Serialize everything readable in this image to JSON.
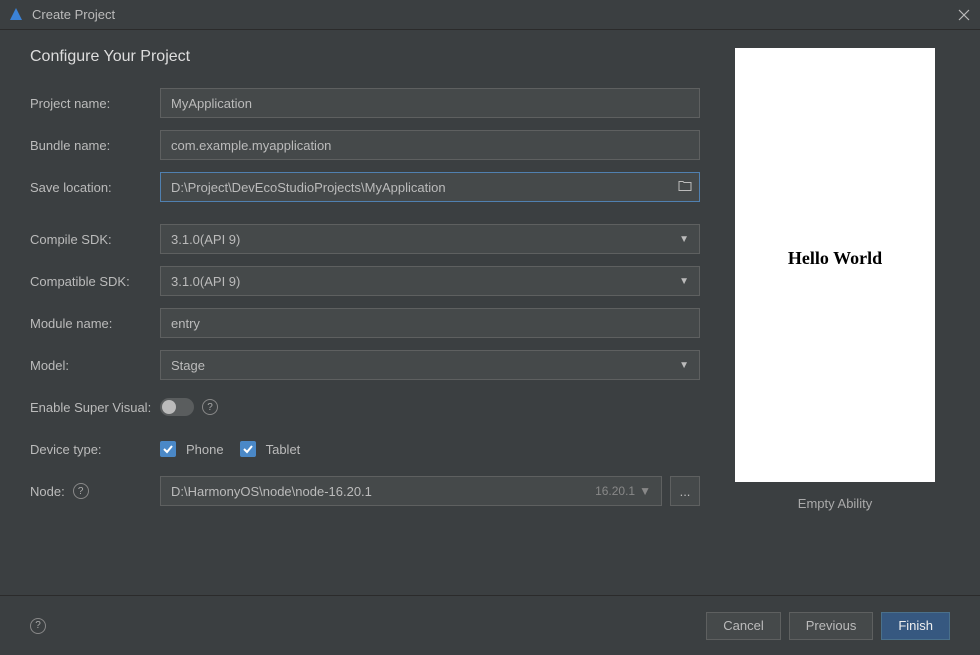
{
  "window": {
    "title": "Create Project"
  },
  "page_title": "Configure Your Project",
  "form": {
    "project_name": {
      "label": "Project name:",
      "value": "MyApplication"
    },
    "bundle_name": {
      "label": "Bundle name:",
      "value": "com.example.myapplication"
    },
    "save_location": {
      "label": "Save location:",
      "value": "D:\\Project\\DevEcoStudioProjects\\MyApplication"
    },
    "compile_sdk": {
      "label": "Compile SDK:",
      "value": "3.1.0(API 9)"
    },
    "compatible_sdk": {
      "label": "Compatible SDK:",
      "value": "3.1.0(API 9)"
    },
    "module_name": {
      "label": "Module name:",
      "value": "entry"
    },
    "model": {
      "label": "Model:",
      "value": "Stage"
    },
    "enable_super_visual": {
      "label": "Enable Super Visual:"
    },
    "device_type": {
      "label": "Device type:",
      "options": [
        {
          "label": "Phone",
          "checked": true
        },
        {
          "label": "Tablet",
          "checked": true
        }
      ]
    },
    "node": {
      "label": "Node:",
      "value": "D:\\HarmonyOS\\node\\node-16.20.1",
      "version": "16.20.1"
    }
  },
  "preview": {
    "content": "Hello World",
    "caption": "Empty Ability"
  },
  "footer": {
    "cancel": "Cancel",
    "previous": "Previous",
    "finish": "Finish"
  }
}
